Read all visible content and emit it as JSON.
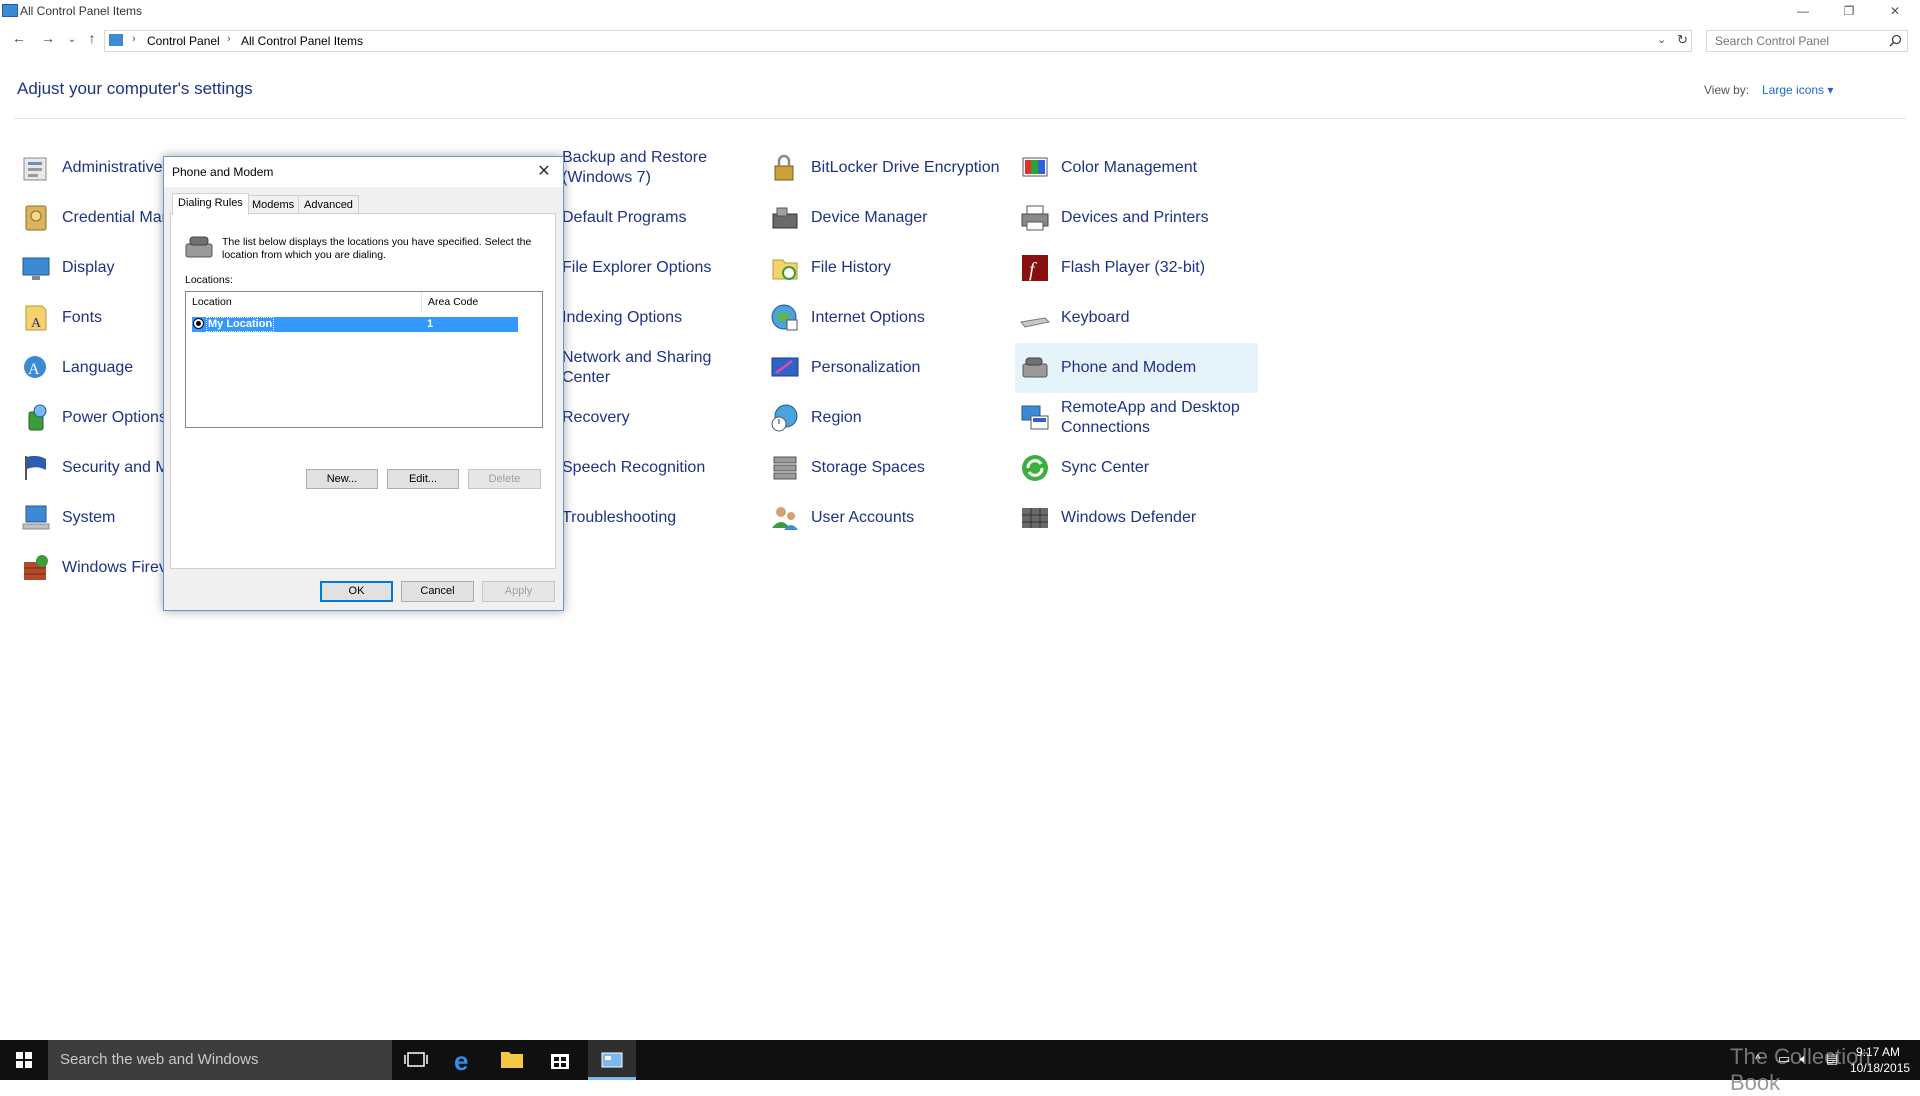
{
  "window": {
    "title": "All Control Panel Items",
    "controls": {
      "minimize": "—",
      "restore": "❐",
      "close": "✕"
    }
  },
  "address": {
    "crumbs": [
      "Control Panel",
      "All Control Panel Items"
    ],
    "search_placeholder": "Search Control Panel"
  },
  "header": {
    "title": "Adjust your computer's settings",
    "view_by_label": "View by:",
    "view_by_value": "Large icons ▾"
  },
  "items": {
    "col1": [
      "Administrative",
      "Credential Man",
      "Display",
      "Fonts",
      "Language",
      "Power Options",
      "Security and M",
      "System",
      "Windows Firev"
    ],
    "col2_first_l1": "Backup and Restore",
    "col2_first_l2": "(Windows 7)",
    "col2": [
      "Default Programs",
      "File Explorer Options",
      "Indexing Options"
    ],
    "col2_network_l1": "Network and Sharing",
    "col2_network_l2": "Center",
    "col2b": [
      "Recovery",
      "Speech Recognition",
      "Troubleshooting"
    ],
    "col3": [
      "BitLocker Drive Encryption",
      "Device Manager",
      "File History",
      "Internet Options",
      "Personalization",
      "Region",
      "Storage Spaces",
      "User Accounts"
    ],
    "col4a": [
      "Color Management",
      "Devices and Printers",
      "Flash Player (32-bit)",
      "Keyboard",
      "Phone and Modem"
    ],
    "col4_remote_l1": "RemoteApp and Desktop",
    "col4_remote_l2": "Connections",
    "col4b": [
      "Sync Center",
      "Windows Defender"
    ]
  },
  "dialog": {
    "title": "Phone and Modem",
    "close": "✕",
    "tabs": [
      "Dialing Rules",
      "Modems",
      "Advanced"
    ],
    "description": "The list below displays the locations you have specified. Select the location from which you are dialing.",
    "locations_label": "Locations:",
    "columns": [
      "Location",
      "Area Code"
    ],
    "rows": [
      {
        "location": "My Location",
        "area_code": "1"
      }
    ],
    "buttons": {
      "new": "New...",
      "edit": "Edit...",
      "delete": "Delete",
      "ok": "OK",
      "cancel": "Cancel",
      "apply": "Apply"
    }
  },
  "taskbar": {
    "search_placeholder": "Search the web and Windows",
    "time": "9:17 AM",
    "date": "10/18/2015",
    "watermark": "The Collection Book"
  },
  "colors": {
    "link": "#1e3287",
    "accent": "#0078d7",
    "selection": "#3399ff",
    "hover": "#e5f3fb"
  }
}
